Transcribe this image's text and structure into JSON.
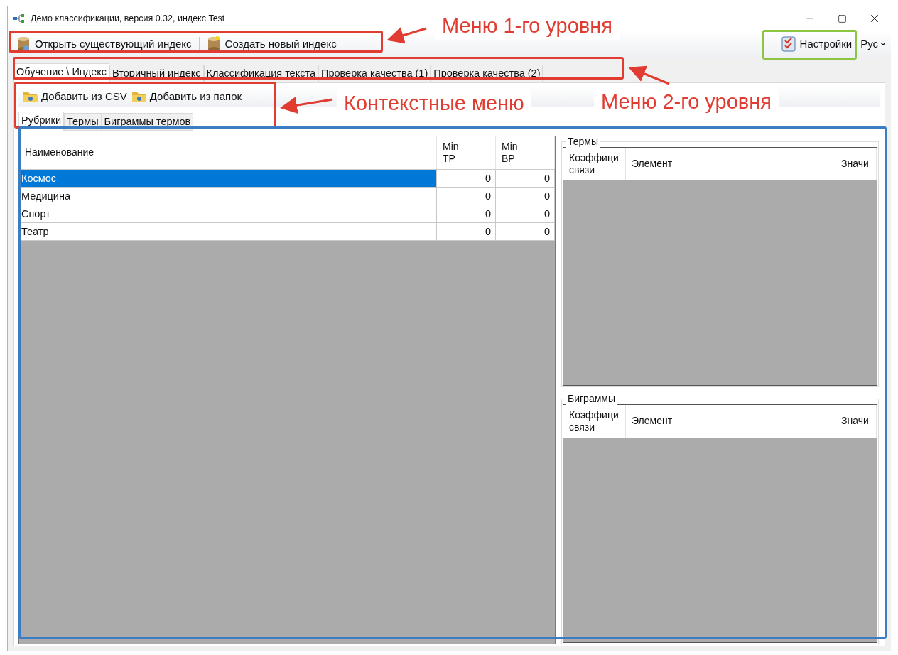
{
  "window": {
    "title": "Демо классификации, версия 0.32, индекс Test"
  },
  "toolbar": {
    "items": [
      {
        "label": "Открыть существующий индекс"
      },
      {
        "label": "Создать новый индекс"
      }
    ],
    "settings": {
      "label": "Настройки"
    },
    "language": {
      "label": "Рус"
    }
  },
  "tabs": [
    {
      "label": "Обучение \\ Индекс",
      "selected": true
    },
    {
      "label": "Вторичный индекс",
      "selected": false
    },
    {
      "label": "Классификация текста",
      "selected": false
    },
    {
      "label": "Проверка качества (1)",
      "selected": false
    },
    {
      "label": "Проверка качества (2)",
      "selected": false
    }
  ],
  "context_toolbar": {
    "items": [
      {
        "label": "Добавить из CSV"
      },
      {
        "label": "Добавить из папок"
      }
    ]
  },
  "subtabs": [
    {
      "label": "Рубрики",
      "selected": true
    },
    {
      "label": "Термы",
      "selected": false
    },
    {
      "label": "Биграммы термов",
      "selected": false
    }
  ],
  "rubrics_table": {
    "columns": [
      "Наименование",
      "Min TP",
      "Min BP"
    ],
    "rows": [
      {
        "cells": [
          "Космос",
          "0",
          "0"
        ],
        "selected": true
      },
      {
        "cells": [
          "Медицина",
          "0",
          "0"
        ],
        "selected": false
      },
      {
        "cells": [
          "Спорт",
          "0",
          "0"
        ],
        "selected": false
      },
      {
        "cells": [
          "Театр",
          "0",
          "0"
        ],
        "selected": false
      }
    ]
  },
  "panels": [
    {
      "title": "Термы",
      "columns": [
        "Коэффици связи",
        "Элемент",
        "Значи"
      ]
    },
    {
      "title": "Биграммы",
      "columns": [
        "Коэффици связи",
        "Элемент",
        "Значи"
      ]
    }
  ],
  "annotations": [
    {
      "text": "Меню 1-го уровня"
    },
    {
      "text": "Контекстные меню"
    },
    {
      "text": "Меню 2-го уровня"
    }
  ]
}
